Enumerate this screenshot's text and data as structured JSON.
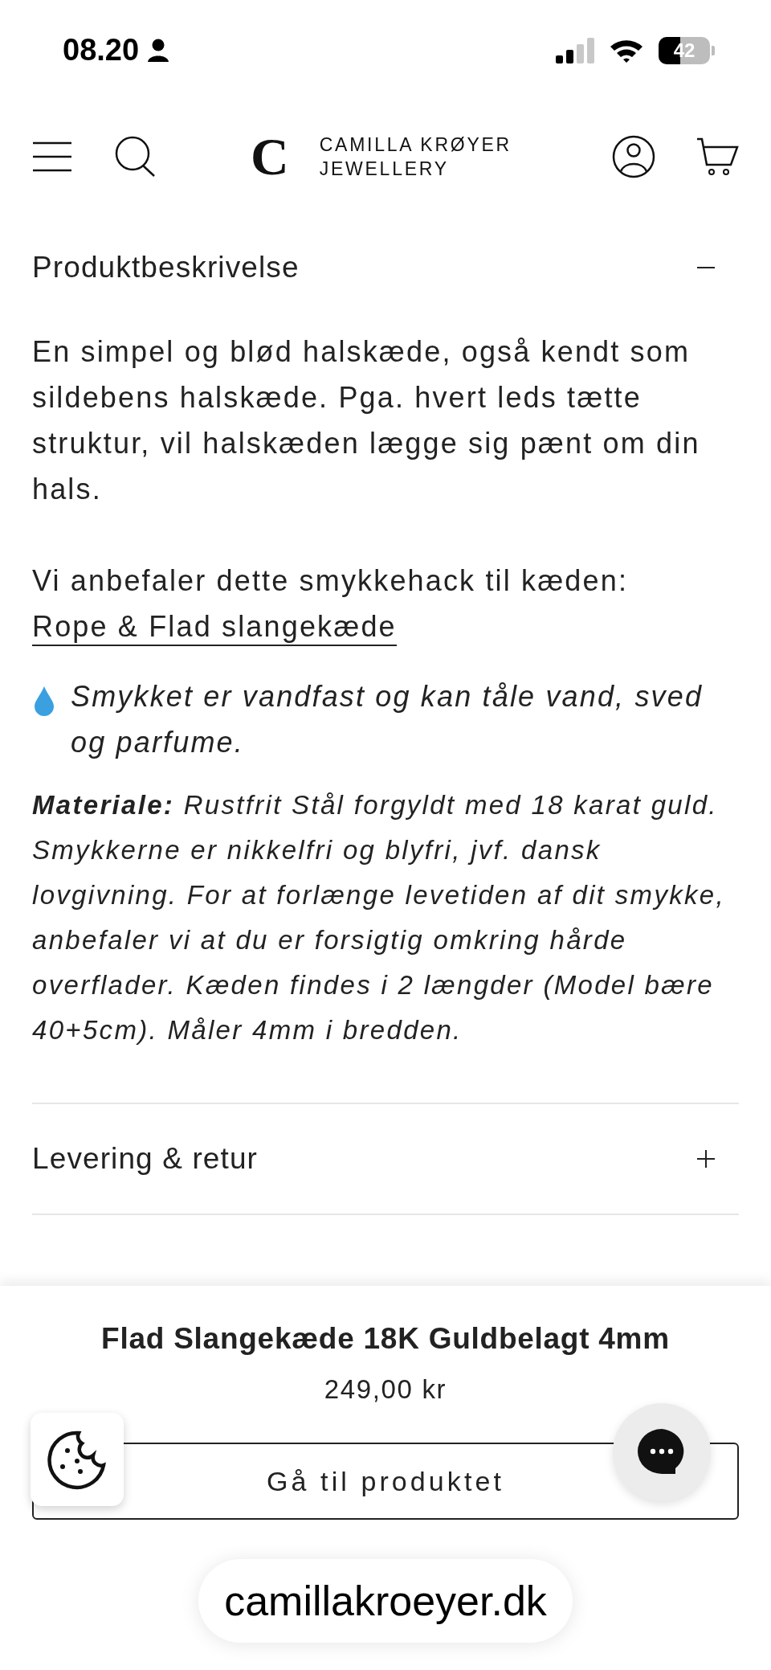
{
  "status_bar": {
    "time": "08.20",
    "battery": "42"
  },
  "header": {
    "logo_mark": "C",
    "logo_lines": [
      "CAMILLA KRØYER",
      "JEWELLERY"
    ]
  },
  "accordions": [
    {
      "title": "Produktbeskrivelse",
      "expanded": true,
      "content": [
        {
          "kind": "text",
          "text": "En simpel og blød halskæde, også kendt som sildebens halskæde. Pga. hvert leds tætte struktur, vil halskæden lægge sig pænt om din hals."
        },
        {
          "kind": "link",
          "text": "Vi anbefaler dette smykkehack til kæden:",
          "link": "Rope & Flad slangekæde"
        },
        {
          "kind": "note",
          "text": "Smykket er vandfast og kan tåle vand, sved og parfume."
        },
        {
          "kind": "rich",
          "text": "**Materiale:** Rustfrit Stål forgyldt med 18 karat guld. Smykkerne er nikkelfri og blyfri, jvf. dansk lovgivning. For at forlænge levetiden af dit smykke, anbefaler vi at du er forsigtig omkring hårde overflader. Kæden findes i 2 længder (Model bære 40+5cm). Måler 4mm i bredden."
        }
      ]
    },
    {
      "title": "Levering & retur",
      "expanded": false
    }
  ],
  "sticky_bar": {
    "name": "Flad Slangekæde 18K Guldbelagt 4mm",
    "price": "249,00 kr",
    "button": "Gå til produktet"
  },
  "browser": {
    "url": "camillakroeyer.dk"
  }
}
